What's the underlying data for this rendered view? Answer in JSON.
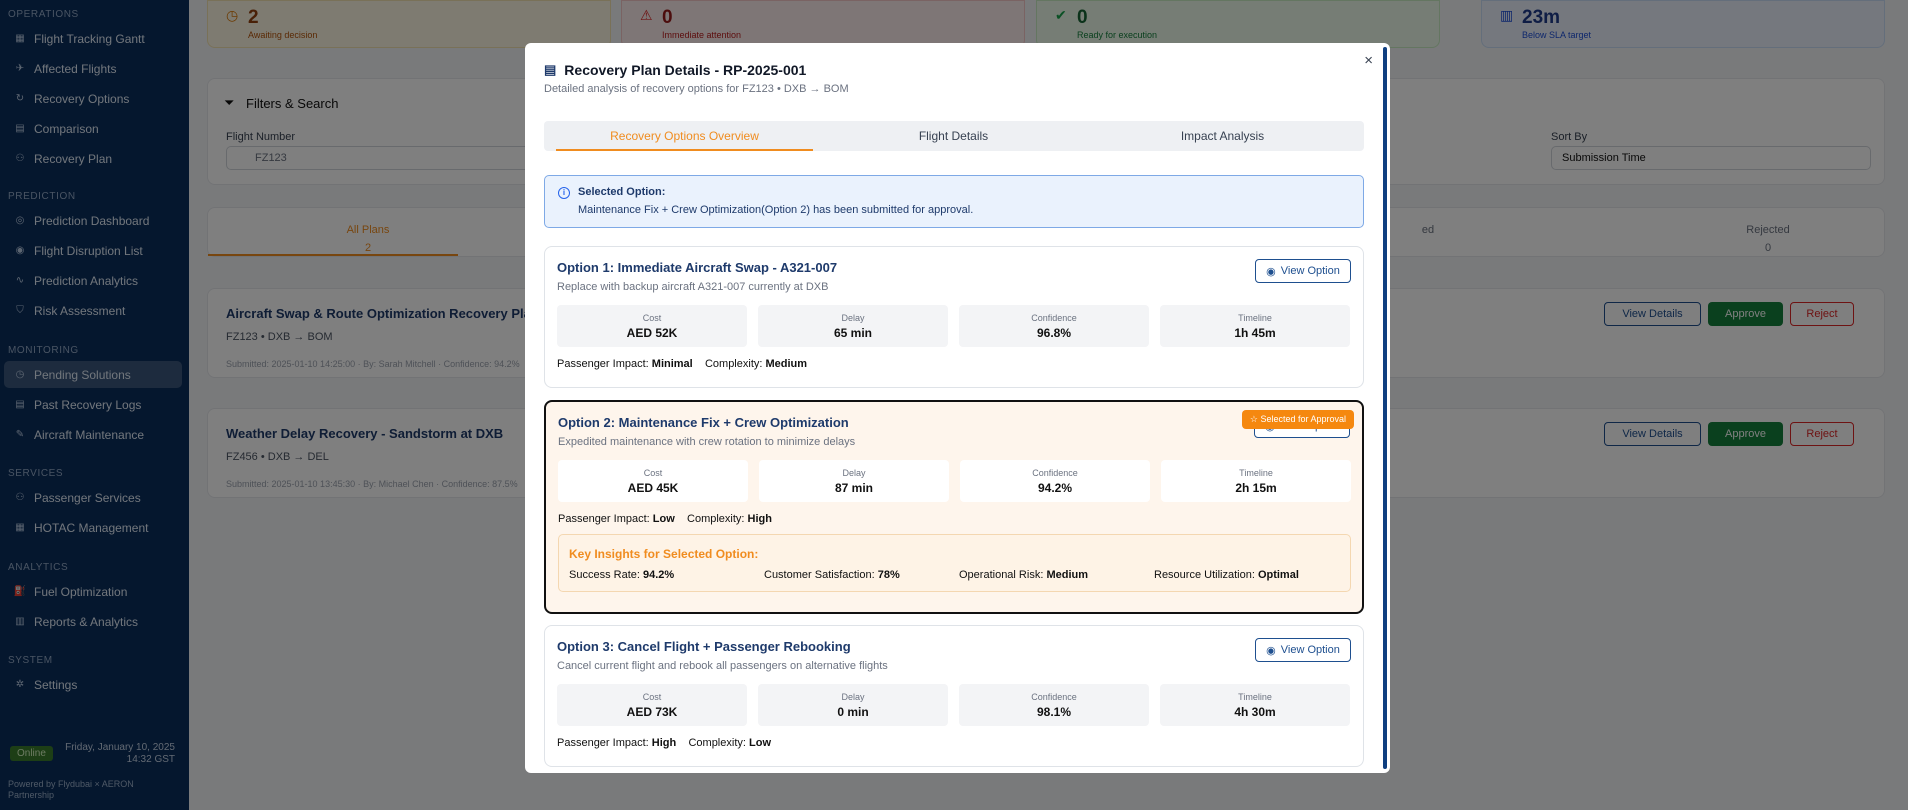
{
  "sidebar": {
    "sections": [
      {
        "title": "OPERATIONS",
        "items": [
          "Flight Tracking Gantt",
          "Affected Flights",
          "Recovery Options",
          "Comparison",
          "Recovery Plan"
        ]
      },
      {
        "title": "PREDICTION",
        "items": [
          "Prediction Dashboard",
          "Flight Disruption List",
          "Prediction Analytics",
          "Risk Assessment"
        ]
      },
      {
        "title": "MONITORING",
        "items": [
          "Pending Solutions",
          "Past Recovery Logs",
          "Aircraft Maintenance"
        ]
      },
      {
        "title": "SERVICES",
        "items": [
          "Passenger Services",
          "HOTAC Management"
        ]
      },
      {
        "title": "ANALYTICS",
        "items": [
          "Fuel Optimization",
          "Reports & Analytics"
        ]
      },
      {
        "title": "SYSTEM",
        "items": [
          "Settings"
        ]
      }
    ],
    "active_item": "Pending Solutions",
    "status": "Online",
    "date": "Friday, January 10, 2025",
    "time": "14:32 GST",
    "powered_by": "Powered by Flydubai × AERON Partnership"
  },
  "background": {
    "stats": [
      {
        "value": "2",
        "label": "Awaiting decision"
      },
      {
        "value": "0",
        "label": "Immediate attention"
      },
      {
        "value": "0",
        "label": "Ready for execution"
      },
      {
        "value": "23m",
        "label": "Below SLA target"
      }
    ],
    "filters_title": "Filters & Search",
    "flight_number_label": "Flight Number",
    "flight_number_value": "FZ123",
    "sort_by_label": "Sort By",
    "sort_by_value": "Submission Time",
    "tabs": [
      {
        "label": "All Plans",
        "count": "2"
      },
      {
        "label": "ed",
        "count": ""
      },
      {
        "label": "Rejected",
        "count": "0"
      }
    ],
    "plans": [
      {
        "title": "Aircraft Swap & Route Optimization Recovery Pla",
        "route": "FZ123 • DXB → BOM",
        "meta": "Submitted: 2025-01-10 14:25:00 · By: Sarah Mitchell · Confidence: 94.2%"
      },
      {
        "title": "Weather Delay Recovery - Sandstorm at DXB",
        "route": "FZ456 • DXB → DEL",
        "meta": "Submitted: 2025-01-10 13:45:30 · By: Michael Chen · Confidence: 87.5%"
      }
    ],
    "view_details": "View Details",
    "approve": "Approve",
    "reject": "Reject"
  },
  "modal": {
    "title": "Recovery Plan Details - RP-2025-001",
    "subtitle": "Detailed analysis of recovery options for FZ123 • DXB → BOM",
    "close": "×",
    "tabs": [
      "Recovery Options Overview",
      "Flight Details",
      "Impact Analysis"
    ],
    "alert_title": "Selected Option:",
    "alert_body": "Maintenance Fix + Crew Optimization(Option 2) has been submitted for approval.",
    "view_option": "View Option",
    "selected_badge": "Selected for Approval",
    "metric_labels": [
      "Cost",
      "Delay",
      "Confidence",
      "Timeline"
    ],
    "passenger_impact_label": "Passenger Impact:",
    "complexity_label": "Complexity:",
    "options": [
      {
        "title": "Option 1: Immediate Aircraft Swap - A321-007",
        "desc": "Replace with backup aircraft A321-007 currently at DXB",
        "cost": "AED 52K",
        "delay": "65 min",
        "confidence": "96.8%",
        "timeline": "1h 45m",
        "impact": "Minimal",
        "complexity": "Medium"
      },
      {
        "title": "Option 2: Maintenance Fix + Crew Optimization",
        "desc": "Expedited maintenance with crew rotation to minimize delays",
        "cost": "AED 45K",
        "delay": "87 min",
        "confidence": "94.2%",
        "timeline": "2h 15m",
        "impact": "Low",
        "complexity": "High"
      },
      {
        "title": "Option 3: Cancel Flight + Passenger Rebooking",
        "desc": "Cancel current flight and rebook all passengers on alternative flights",
        "cost": "AED 73K",
        "delay": "0 min",
        "confidence": "98.1%",
        "timeline": "4h 30m",
        "impact": "High",
        "complexity": "Low"
      }
    ],
    "insights": {
      "title": "Key Insights for Selected Option:",
      "items": [
        {
          "label": "Success Rate:",
          "value": "94.2%"
        },
        {
          "label": "Customer Satisfaction:",
          "value": "78%"
        },
        {
          "label": "Operational Risk:",
          "value": "Medium"
        },
        {
          "label": "Resource Utilization:",
          "value": "Optimal"
        }
      ]
    }
  }
}
